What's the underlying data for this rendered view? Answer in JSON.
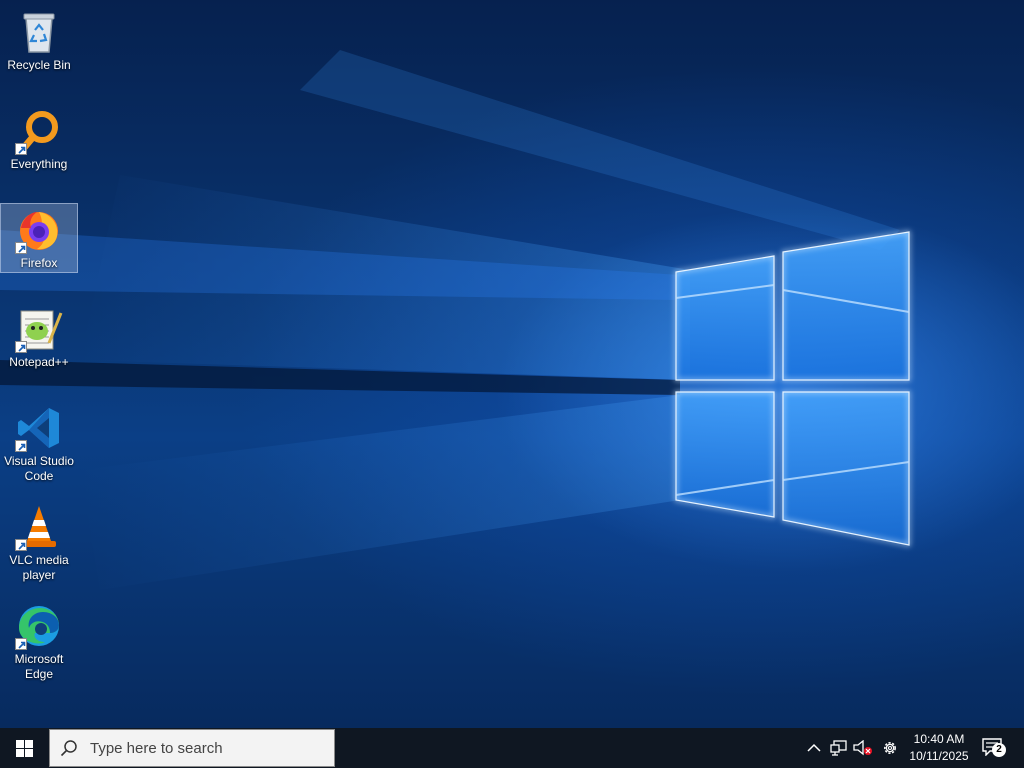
{
  "desktop": {
    "wallpaper": "windows-10-hero-wallpaper",
    "icons": [
      {
        "label": "Recycle Bin",
        "icon": "recycle-bin-icon",
        "shortcut": false,
        "selected": false
      },
      {
        "label": "Everything",
        "icon": "everything-search-icon",
        "shortcut": true,
        "selected": false
      },
      {
        "label": "Firefox",
        "icon": "firefox-icon",
        "shortcut": true,
        "selected": true
      },
      {
        "label": "Notepad++",
        "icon": "notepad-plus-plus-icon",
        "shortcut": true,
        "selected": false
      },
      {
        "label": "Visual Studio Code",
        "icon": "vscode-icon",
        "shortcut": true,
        "selected": false
      },
      {
        "label": "VLC media player",
        "icon": "vlc-icon",
        "shortcut": true,
        "selected": false
      },
      {
        "label": "Microsoft Edge",
        "icon": "edge-icon",
        "shortcut": true,
        "selected": false
      }
    ]
  },
  "taskbar": {
    "start_icon": "windows-logo-icon",
    "search": {
      "placeholder": "Type here to search",
      "icon": "search-icon"
    },
    "tray": {
      "icons": [
        "chevron-up-icon",
        "network-icon",
        "volume-muted-icon",
        "gear-icon"
      ],
      "time": "10:40 AM",
      "date": "10/11/2025",
      "notifications": {
        "icon": "notification-center-icon",
        "count": "2"
      }
    }
  },
  "colors": {
    "taskbar_bg": "#0f1722",
    "accent_blue": "#1a73e8",
    "muted_red": "#e81123"
  }
}
